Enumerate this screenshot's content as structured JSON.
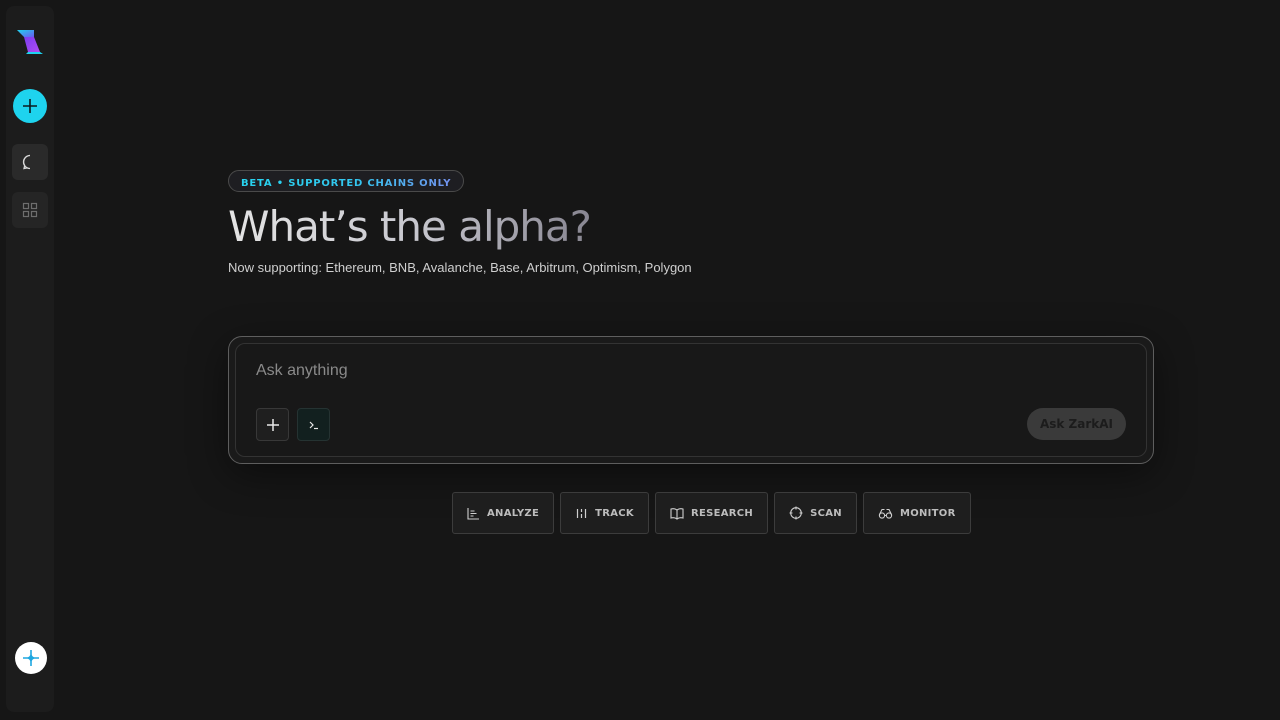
{
  "badge": "BETA • SUPPORTED CHAINS ONLY",
  "title": "What’s the alpha?",
  "subtitle": "Now supporting: Ethereum, BNB, Avalanche, Base, Arbitrum, Optimism, Polygon",
  "prompt": {
    "placeholder": "Ask anything",
    "submit_label": "Ask ZarkAI"
  },
  "actions": [
    {
      "label": "ANALYZE",
      "icon": "bar-chart-icon"
    },
    {
      "label": "TRACK",
      "icon": "track-icon"
    },
    {
      "label": "RESEARCH",
      "icon": "book-icon"
    },
    {
      "label": "SCAN",
      "icon": "crosshair-icon"
    },
    {
      "label": "MONITOR",
      "icon": "binoculars-icon"
    }
  ],
  "colors": {
    "accent": "#1ed3ee",
    "background": "#161616"
  }
}
